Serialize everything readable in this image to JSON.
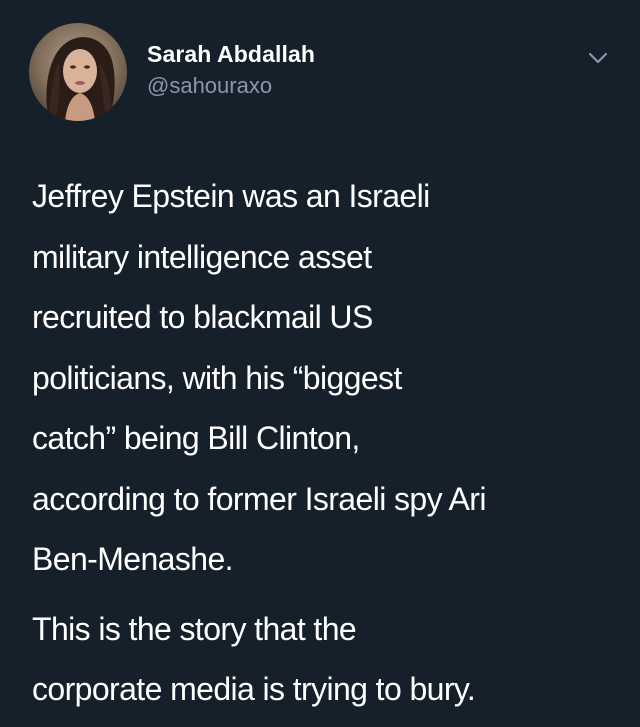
{
  "author": {
    "display_name": "Sarah Abdallah",
    "handle": "@sahouraxo"
  },
  "tweet": {
    "paragraph_1_lines": [
      "Jeffrey Epstein was an Israeli",
      "military intelligence asset",
      "recruited to blackmail US",
      "politicians, with his “biggest",
      "catch” being Bill Clinton,",
      "according to former Israeli spy Ari",
      "Ben-Menashe."
    ],
    "paragraph_2_lines": [
      "This is the story that the",
      "corporate media is trying to bury."
    ]
  },
  "icons": {
    "menu": "chevron-down-icon",
    "avatar": "profile-photo"
  },
  "colors": {
    "background": "#15202b",
    "text": "#ffffff",
    "secondary_text": "#8899a6"
  }
}
